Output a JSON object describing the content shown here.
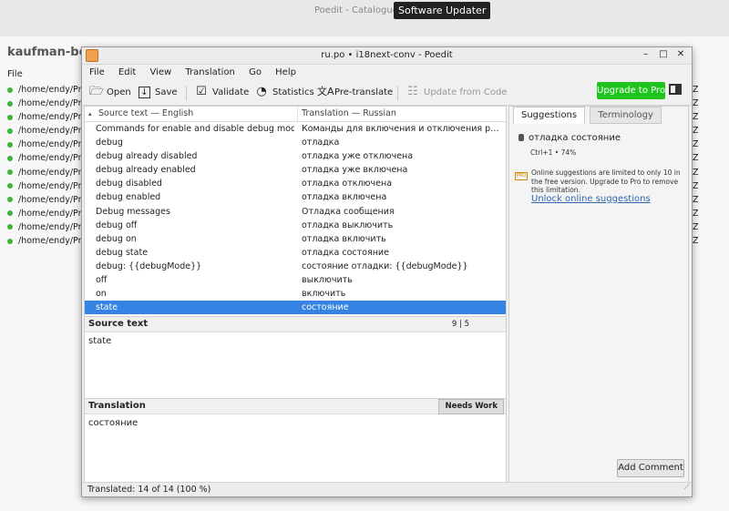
{
  "background": {
    "title": "Poedit - Catalogues m",
    "project": "kaufman-bot",
    "file_header": "File",
    "files": [
      "/home/endy/Pro",
      "/home/endy/Pro",
      "/home/endy/Pro",
      "/home/endy/Pro",
      "/home/endy/Pro",
      "/home/endy/Pro",
      "/home/endy/Pro",
      "/home/endy/Pro",
      "/home/endy/Pro",
      "/home/endy/Pro",
      "/home/endy/Pro",
      "/home/endy/Pro"
    ],
    "right_col": [
      "Z",
      "Z",
      "Z",
      "Z",
      "Z",
      "Z",
      "Z",
      "Z",
      "Z",
      "Z",
      "Z",
      "Z"
    ],
    "status_color": "#3bb53b"
  },
  "tooltip": "Software Updater",
  "window": {
    "title": "ru.po • i18next-conv - Poedit",
    "controls": [
      "–",
      "□",
      "✕"
    ]
  },
  "menu": [
    "File",
    "Edit",
    "View",
    "Translation",
    "Go",
    "Help"
  ],
  "toolbar": {
    "open": "Open",
    "save": "Save",
    "validate": "Validate",
    "statistics": "Statistics",
    "pretranslate": "Pre-translate",
    "update": "Update from Code",
    "upgrade": "Upgrade to Pro",
    "upgrade_color": "#1fc41f"
  },
  "list": {
    "col_source": "Source text — English",
    "col_translation": "Translation — Russian",
    "rows": [
      {
        "src": "Commands for enable and disable debug mode",
        "tr": "Команды для включения и отключения режи..."
      },
      {
        "src": "debug",
        "tr": "отладка"
      },
      {
        "src": "debug already disabled",
        "tr": "отладка уже отключена"
      },
      {
        "src": "debug already enabled",
        "tr": "отладка уже включена"
      },
      {
        "src": "debug disabled",
        "tr": "отладка отключена"
      },
      {
        "src": "debug enabled",
        "tr": "отладка включена"
      },
      {
        "src": "Debug messages",
        "tr": "Отладка сообщения"
      },
      {
        "src": "debug off",
        "tr": "отладка выключить"
      },
      {
        "src": "debug on",
        "tr": "отладка включить"
      },
      {
        "src": "debug state",
        "tr": "отладка состояние"
      },
      {
        "src": "debug: {{debugMode}}",
        "tr": "состояние отладки: {{debugMode}}"
      },
      {
        "src": "off",
        "tr": "выключить"
      },
      {
        "src": "on",
        "tr": "включить"
      },
      {
        "src": "state",
        "tr": "состояние"
      }
    ],
    "selected_index": 13,
    "selected_color": "#3584e4"
  },
  "source": {
    "header": "Source text",
    "count": "9 | 5",
    "text": "state"
  },
  "translation": {
    "header": "Translation",
    "needs_work": "Needs Work",
    "text": "состояние"
  },
  "sidebar": {
    "tab_suggestions": "Suggestions",
    "tab_terminology": "Terminology",
    "suggestion": "отладка состояние",
    "suggestion_meta": "Ctrl+1 • 74%",
    "pro_badge": "PRO",
    "pro_message": "Online suggestions are limited to only 10 in the free version. Upgrade to Pro to remove this limitation.",
    "unlock": "Unlock online suggestions",
    "add_comment": "Add Comment"
  },
  "status": "Translated: 14 of 14 (100 %)"
}
